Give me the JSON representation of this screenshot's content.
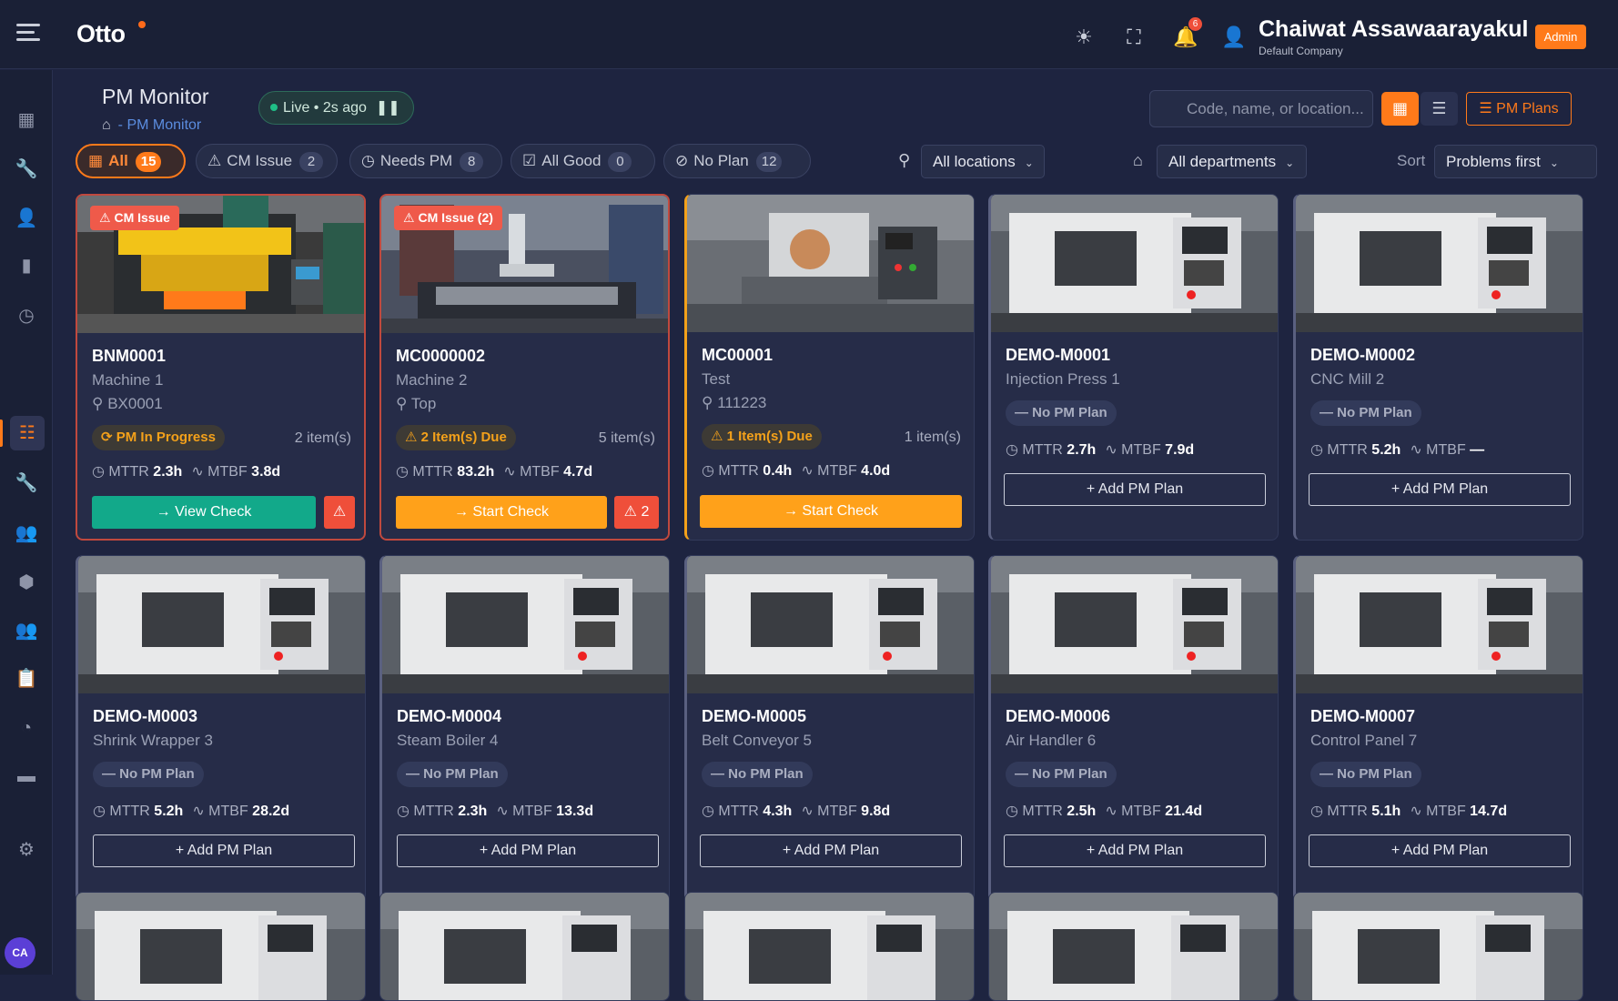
{
  "header": {
    "logo": "Otto",
    "notif_count": "6",
    "user_name": "Chaiwat Assawaarayakul",
    "company": "Default Company",
    "role": "Admin"
  },
  "sidebar": {
    "avatar": "CA",
    "items": [
      "dashboard-icon",
      "wrench-icon",
      "user-icon",
      "chart-icon",
      "clock-icon",
      "pm-monitor-icon",
      "tool-icon",
      "team-icon",
      "box-icon",
      "people-icon",
      "clipboard-icon",
      "pie-icon",
      "folder-icon",
      "gear-icon"
    ]
  },
  "page": {
    "title": "PM Monitor",
    "breadcrumb": "PM Monitor",
    "live": "Live • 2s ago"
  },
  "toolbar": {
    "search_placeholder": "Code, name, or location...",
    "pm_plans": "PM Plans"
  },
  "filters": [
    {
      "label": "All",
      "count": "15"
    },
    {
      "label": "CM Issue",
      "count": "2"
    },
    {
      "label": "Needs PM",
      "count": "8"
    },
    {
      "label": "All Good",
      "count": "0"
    },
    {
      "label": "No Plan",
      "count": "12"
    }
  ],
  "selects": {
    "location": "All locations",
    "department": "All departments",
    "sort_label": "Sort",
    "sort": "Problems first"
  },
  "labels": {
    "mttr": "MTTR",
    "mtbf": "MTBF"
  },
  "cards": [
    {
      "code": "BNM0001",
      "name": "Machine 1",
      "loc": "BX0001",
      "badge": "CM Issue",
      "status": "PM In Progress",
      "items": "2 item(s)",
      "mttr": "2.3h",
      "mtbf": "3.8d",
      "action": "View Check",
      "alert": ""
    },
    {
      "code": "MC0000002",
      "name": "Machine 2",
      "loc": "Top",
      "badge": "CM Issue (2)",
      "status": "2 Item(s) Due",
      "items": "5 item(s)",
      "mttr": "83.2h",
      "mtbf": "4.7d",
      "action": "Start Check",
      "alert": "2"
    },
    {
      "code": "MC00001",
      "name": "Test",
      "loc": "111223",
      "badge": "",
      "status": "1 Item(s) Due",
      "items": "1 item(s)",
      "mttr": "0.4h",
      "mtbf": "4.0d",
      "action": "Start Check",
      "alert": ""
    },
    {
      "code": "DEMO-M0001",
      "name": "Injection Press 1",
      "loc": "",
      "badge": "",
      "status": "No PM Plan",
      "items": "",
      "mttr": "2.7h",
      "mtbf": "7.9d",
      "action": "Add PM Plan",
      "alert": ""
    },
    {
      "code": "DEMO-M0002",
      "name": "CNC Mill 2",
      "loc": "",
      "badge": "",
      "status": "No PM Plan",
      "items": "",
      "mttr": "5.2h",
      "mtbf": "—",
      "action": "Add PM Plan",
      "alert": ""
    },
    {
      "code": "DEMO-M0003",
      "name": "Shrink Wrapper 3",
      "loc": "",
      "badge": "",
      "status": "No PM Plan",
      "items": "",
      "mttr": "5.2h",
      "mtbf": "28.2d",
      "action": "Add PM Plan",
      "alert": ""
    },
    {
      "code": "DEMO-M0004",
      "name": "Steam Boiler 4",
      "loc": "",
      "badge": "",
      "status": "No PM Plan",
      "items": "",
      "mttr": "2.3h",
      "mtbf": "13.3d",
      "action": "Add PM Plan",
      "alert": ""
    },
    {
      "code": "DEMO-M0005",
      "name": "Belt Conveyor 5",
      "loc": "",
      "badge": "",
      "status": "No PM Plan",
      "items": "",
      "mttr": "4.3h",
      "mtbf": "9.8d",
      "action": "Add PM Plan",
      "alert": ""
    },
    {
      "code": "DEMO-M0006",
      "name": "Air Handler 6",
      "loc": "",
      "badge": "",
      "status": "No PM Plan",
      "items": "",
      "mttr": "2.5h",
      "mtbf": "21.4d",
      "action": "Add PM Plan",
      "alert": ""
    },
    {
      "code": "DEMO-M0007",
      "name": "Control Panel 7",
      "loc": "",
      "badge": "",
      "status": "No PM Plan",
      "items": "",
      "mttr": "5.1h",
      "mtbf": "14.7d",
      "action": "Add PM Plan",
      "alert": ""
    }
  ]
}
